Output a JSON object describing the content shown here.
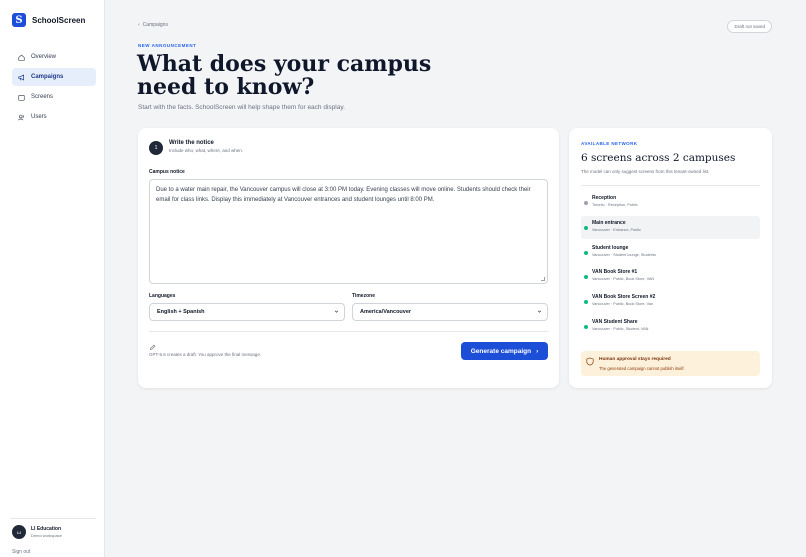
{
  "brand": {
    "name": "SchoolScreen",
    "logo_letter": "S"
  },
  "nav": {
    "items": [
      {
        "label": "Overview",
        "icon": "home-icon",
        "active": false
      },
      {
        "label": "Campaigns",
        "icon": "megaphone-icon",
        "active": true
      },
      {
        "label": "Screens",
        "icon": "monitor-icon",
        "active": false
      },
      {
        "label": "Users",
        "icon": "users-icon",
        "active": false
      }
    ]
  },
  "user": {
    "initials": "LI",
    "name": "LI Education",
    "workspace": "Demo workspace",
    "signout": "Sign out"
  },
  "header": {
    "breadcrumb": "Campaigns",
    "draft_status": "Draft not saved",
    "eyebrow": "NEW ANNOUNCEMENT",
    "title": "What does your campus need to know?",
    "subtitle": "Start with the facts. SchoolScreen will help shape them for each display."
  },
  "notice_card": {
    "step_number": "1",
    "step_title": "Write the notice",
    "step_subtitle": "Include who, what, where, and when.",
    "campus_notice_label": "Campus notice",
    "campus_notice_value": "Due to a water main repair, the Vancouver campus will close at 3:00 PM today. Evening classes will move online. Students should check their email for class links. Display this immediately at Vancouver entrances and student lounges until 8:00 PM.",
    "languages_label": "Languages",
    "languages_value": "English + Spanish",
    "timezone_label": "Timezone",
    "timezone_value": "America/Vancouver",
    "footnote": "GPT-5.6 creates a draft. You approve the final message.",
    "generate_label": "Generate campaign"
  },
  "network_card": {
    "eyebrow": "AVAILABLE NETWORK",
    "title": "6 screens across 2 campuses",
    "subtitle": "The model can only suggest screens from this tenant-owned list.",
    "screens": [
      {
        "name": "Reception",
        "meta": "Toronto · Reception, Public",
        "status": "inactive"
      },
      {
        "name": "Main entrance",
        "meta": "Vancouver · Entrance, Public",
        "status": "active"
      },
      {
        "name": "Student lounge",
        "meta": "Vancouver · Student lounge, Students",
        "status": "active"
      },
      {
        "name": "VAN Book Store #1",
        "meta": "Vancouver · Public, Book Store, VAN",
        "status": "active"
      },
      {
        "name": "VAN Book Store Screen #2",
        "meta": "Vancouver · Public, Book Store, Van",
        "status": "active"
      },
      {
        "name": "VAN Student Share",
        "meta": "Vancouver · Public, Student, VAN",
        "status": "active"
      }
    ],
    "approval_title": "Human approval stays required",
    "approval_subtitle": "The generated campaign cannot publish itself."
  },
  "colors": {
    "accent": "#1d4ed8",
    "active_dot": "#10b981",
    "inactive_dot": "#9ca3af",
    "warning_bg": "#fdf1dc"
  }
}
